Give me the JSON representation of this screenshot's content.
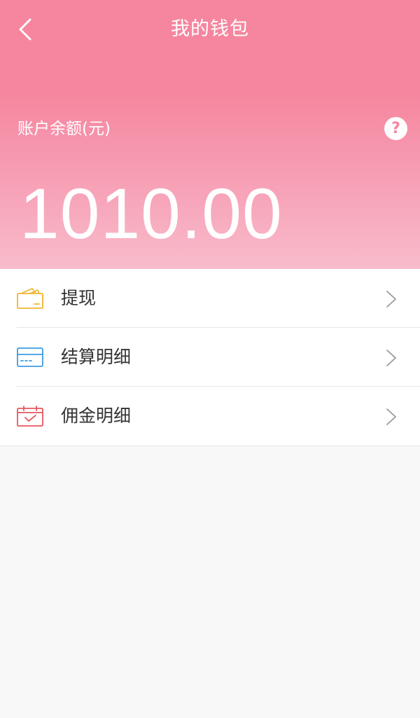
{
  "nav": {
    "title": "我的钱包"
  },
  "wallet": {
    "balance_label": "账户余额(元)",
    "help_glyph": "?",
    "balance_value": "1010.00"
  },
  "menu": {
    "items": [
      {
        "label": "提现",
        "icon": "wallet-icon",
        "icon_color": "#f2b431"
      },
      {
        "label": "结算明细",
        "icon": "card-icon",
        "icon_color": "#3d9be4"
      },
      {
        "label": "佣金明细",
        "icon": "calendar-check-icon",
        "icon_color": "#e8555e"
      }
    ]
  },
  "colors": {
    "header_top": "#f6869f",
    "header_bottom": "#f8bccb",
    "page_background": "#f8f8f8",
    "text_primary": "#333333",
    "divider": "#e6e6e6"
  }
}
